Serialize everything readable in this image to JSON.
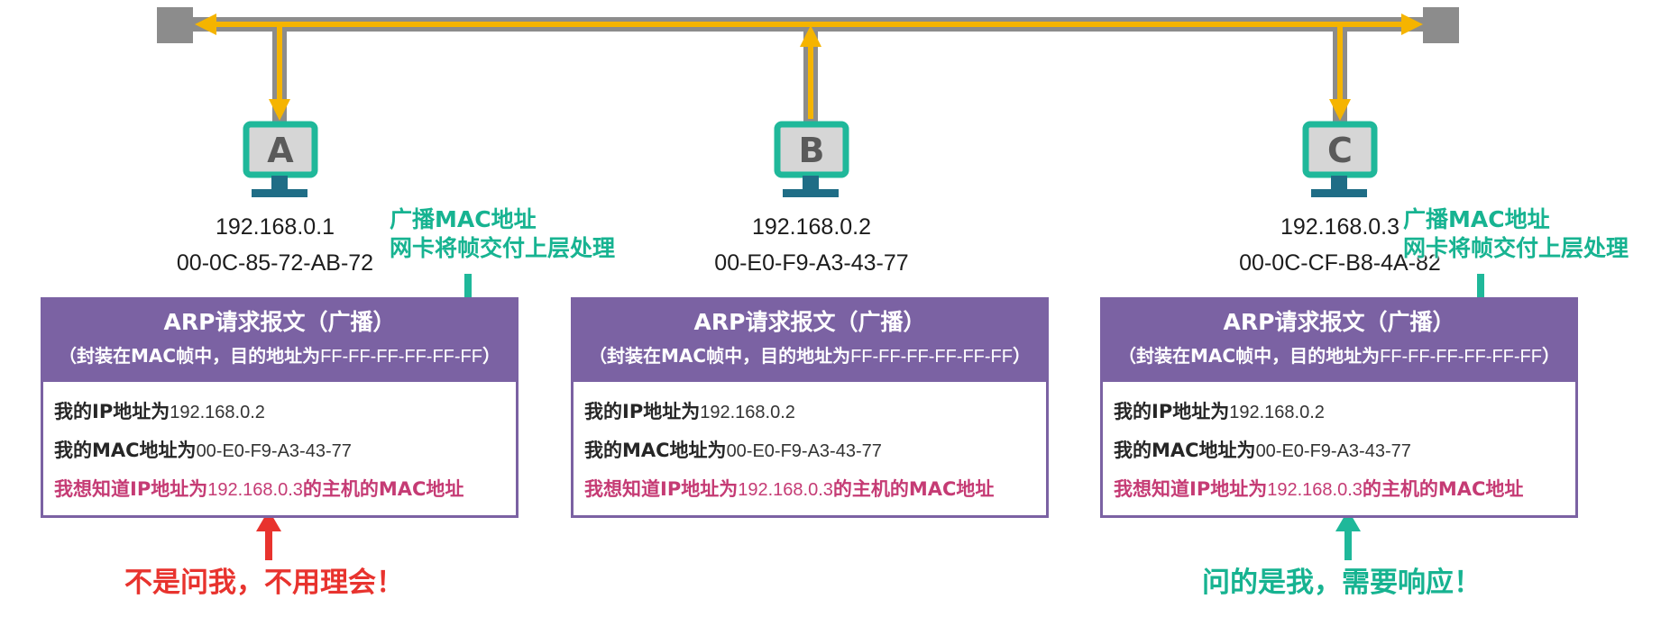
{
  "hosts": [
    {
      "id": "A",
      "ip": "192.168.0.1",
      "mac": "00-0C-85-72-AB-72"
    },
    {
      "id": "B",
      "ip": "192.168.0.2",
      "mac": "00-E0-F9-A3-43-77"
    },
    {
      "id": "C",
      "ip": "192.168.0.3",
      "mac": "00-0C-CF-B8-4A-82"
    }
  ],
  "callouts": {
    "line1": "广播MAC地址",
    "line2": "网卡将帧交付上层处理"
  },
  "arp_box": {
    "title": "ARP请求报文（广播）",
    "subtitle_prefix": "（封装在MAC帧中，目的地址为",
    "subtitle_mac": "FF-FF-FF-FF-FF-FF",
    "subtitle_suffix": "）",
    "row1_label": "我的IP地址为",
    "row1_value": "192.168.0.2",
    "row2_label": "我的MAC地址为",
    "row2_value": "00-E0-F9-A3-43-77",
    "row3_prefix": "我想知道IP地址为",
    "row3_value": "192.168.0.3",
    "row3_suffix": "的主机的MAC地址"
  },
  "verdicts": {
    "a": "不是问我，不用理会！",
    "c": "问的是我，需要响应！"
  },
  "colors": {
    "bus": "#8c8c8c",
    "signal": "#f5b400",
    "host_frame": "#1fb89a",
    "host_screen": "#d6d6d6",
    "host_stand": "#1f6d86",
    "box_purple": "#7b62a3",
    "callout_teal": "#17b391",
    "query_pink": "#c53b74",
    "reject_red": "#e8332e"
  }
}
